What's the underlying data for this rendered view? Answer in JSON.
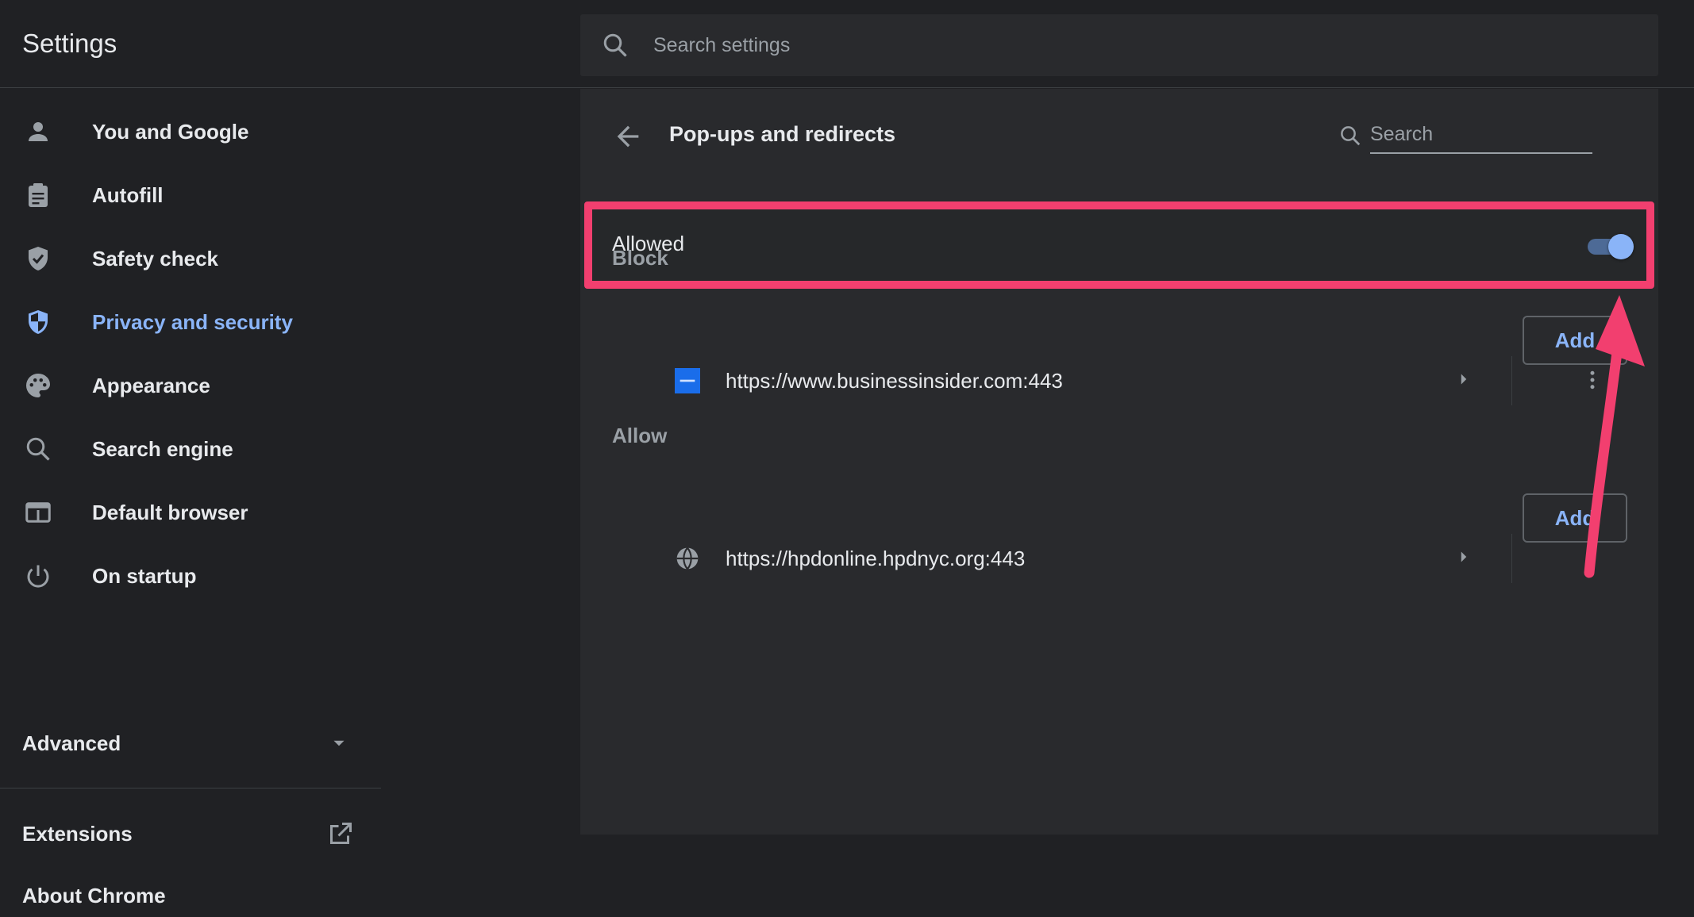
{
  "app": {
    "title": "Settings"
  },
  "search": {
    "placeholder": "Search settings"
  },
  "sidebar": {
    "items": [
      {
        "label": "You and Google",
        "icon": "person-icon",
        "active": false
      },
      {
        "label": "Autofill",
        "icon": "clipboard-icon",
        "active": false
      },
      {
        "label": "Safety check",
        "icon": "shield-check-icon",
        "active": false
      },
      {
        "label": "Privacy and security",
        "icon": "shield-half-icon",
        "active": true
      },
      {
        "label": "Appearance",
        "icon": "palette-icon",
        "active": false
      },
      {
        "label": "Search engine",
        "icon": "search-icon",
        "active": false
      },
      {
        "label": "Default browser",
        "icon": "browser-window-icon",
        "active": false
      },
      {
        "label": "On startup",
        "icon": "power-icon",
        "active": false
      }
    ],
    "advanced_label": "Advanced",
    "extensions_label": "Extensions",
    "about_label": "About Chrome"
  },
  "subpage": {
    "title": "Pop-ups and redirects",
    "search_placeholder": "Search",
    "allowed_label": "Allowed",
    "allowed_on": true,
    "block": {
      "label": "Block",
      "add_label": "Add",
      "sites": [
        {
          "url": "https://www.businessinsider.com:443",
          "favicon": "insider-favicon"
        }
      ]
    },
    "allow": {
      "label": "Allow",
      "add_label": "Add",
      "sites": [
        {
          "url": "https://hpdonline.hpdnyc.org:443",
          "favicon": "globe-icon"
        }
      ]
    }
  },
  "colors": {
    "background": "#202124",
    "panel": "#292a2d",
    "accent": "#8ab4f8",
    "highlight_annotation": "#f23f6f"
  }
}
